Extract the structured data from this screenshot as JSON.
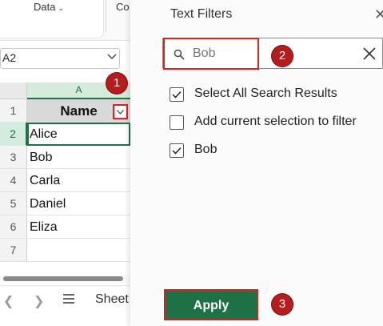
{
  "ribbon": {
    "data_label": "Data",
    "co_label": "Co"
  },
  "namebox": {
    "value": "A2"
  },
  "grid": {
    "column_a": "A",
    "rows": [
      {
        "num": "1",
        "value": "Name"
      },
      {
        "num": "2",
        "value": "Alice"
      },
      {
        "num": "3",
        "value": "Bob"
      },
      {
        "num": "4",
        "value": "Carla"
      },
      {
        "num": "5",
        "value": "Daniel"
      },
      {
        "num": "6",
        "value": "Eliza"
      },
      {
        "num": "7",
        "value": ""
      }
    ]
  },
  "sheetbar": {
    "sheet_label": "Sheet"
  },
  "pane": {
    "title": "Text Filters",
    "search": {
      "value": "Bob",
      "placeholder": "Bob"
    },
    "options": [
      {
        "label": "Select All Search Results",
        "checked": true
      },
      {
        "label": "Add current selection to filter",
        "checked": false
      },
      {
        "label": "Bob",
        "checked": true
      }
    ],
    "apply_label": "Apply"
  },
  "markers": {
    "one": "1",
    "two": "2",
    "three": "3"
  },
  "colors": {
    "excel_green": "#1e7145",
    "header_green": "#d3ecdc",
    "highlight_red": "#e02020",
    "marker_red": "#b51c1c"
  }
}
